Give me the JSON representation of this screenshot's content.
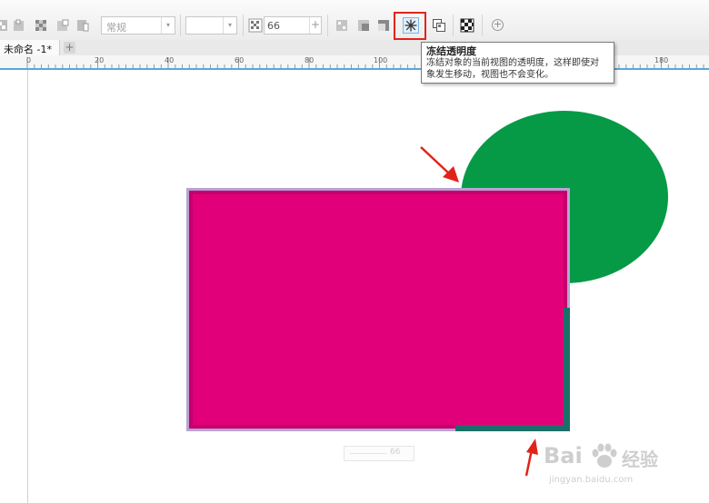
{
  "toolbar": {
    "blend_mode_value": "常规",
    "color_combo_value": "",
    "transparency_value": "66",
    "increment_symbol": "+",
    "dropdown_arrow": "▾",
    "add_symbol": "+"
  },
  "document": {
    "tab_label": "未命名 -1*",
    "add_tab_symbol": "+"
  },
  "ruler": {
    "labels": [
      "0",
      "20",
      "40",
      "60",
      "80",
      "100",
      "180"
    ]
  },
  "tooltip": {
    "title": "冻结透明度",
    "body_line1": "冻结对象的当前视图的透明度，这样即使对",
    "body_line2": "象发生移动，视图也不会变化。"
  },
  "slider": {
    "value": "66"
  },
  "watermark": {
    "brand_text": "Bai",
    "brand_suffix": "经验",
    "url": "jingyan.baidu.com"
  },
  "colors": {
    "ellipse_fill": "#069a46",
    "rect_fill": "#e1007a",
    "rect_border": "#c6006b",
    "rect_outline": "#b9a3d4",
    "overlap_fill": "#1a7069",
    "annotation_red": "#e2231a"
  }
}
